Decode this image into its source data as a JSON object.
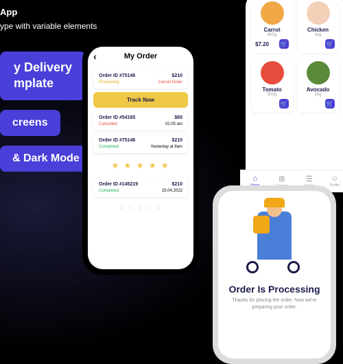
{
  "hero": {
    "line1": "App",
    "line2": "ype with variable elements",
    "title1": "y Delivery",
    "title2": "mplate",
    "pill2": "creens",
    "pill3": "& Dark Mode"
  },
  "phone1": {
    "title": "My Order",
    "orders": [
      {
        "id": "Order ID #75146",
        "price": "$210",
        "status": "Processing",
        "action": "Cancel Order",
        "st": "proc"
      },
      {
        "id": "Order ID #54165",
        "price": "$65",
        "status": "Cancelled",
        "date": "02.05 am",
        "st": "cancel"
      },
      {
        "id": "Order ID #75146",
        "price": "$210",
        "status": "Completed",
        "date": "Yesterday at 8am",
        "st": "comp"
      },
      {
        "id": "Order ID #145219",
        "price": "$210",
        "status": "Completed",
        "date": "15.04.2022",
        "st": "comp"
      }
    ],
    "track": "Track Now"
  },
  "phone2": {
    "products": [
      {
        "name": "Carrot",
        "wt": "800g",
        "price": "$7.20",
        "color": "#f0a847"
      },
      {
        "name": "Chicken",
        "wt": "1kg",
        "price": "",
        "color": "#f4d0b8"
      },
      {
        "name": "Tomato",
        "wt": "500g",
        "price": "",
        "color": "#e74c3c"
      },
      {
        "name": "Avocado",
        "wt": "1kg",
        "price": "",
        "color": "#5a8a3a"
      }
    ],
    "tabs": [
      {
        "label": "Home",
        "icon": "⌂"
      },
      {
        "label": "Category",
        "icon": "⊞"
      },
      {
        "label": "Orders",
        "icon": "☰"
      },
      {
        "label": "Profile",
        "icon": "☺"
      }
    ]
  },
  "phone3": {
    "title": "Order Is Processing",
    "sub": "Thanks for placing the order. Now we're preparing your order."
  }
}
